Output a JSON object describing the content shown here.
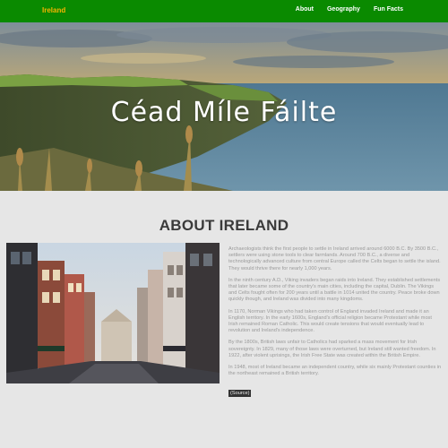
{
  "nav": {
    "brand": "Ireland",
    "links": [
      "About",
      "Geography",
      "Fun Facts"
    ]
  },
  "hero": {
    "title": "Céad Míle Fáilte"
  },
  "about": {
    "heading": "ABOUT IRELAND",
    "paragraphs": [
      "Archaeologists think the first people to settle in Ireland arrived around 6000 B.C. By 3500 B.C., settlers were using stone tools to clear farmlands. Around 700 B.C., a diverse and technologically advanced culture from central Europe called the Celts began to settle the island. They would thrive there for nearly 1,000 years.",
      "In the ninth century A.D., Viking invaders began raids into Ireland. They established settlements that later became some of the country's main cities, including the capital, Dublin. The Vikings and Celts fought often for 200 years until a battle in 1014 united the country. Peace broke down quickly though, and Ireland was divided into many kingdoms.",
      "In 1170, Norman Vikings who had taken control of England invaded Ireland and made it an English territory. In the early 1600s, England's official religion became Protestant while most Irish remained Roman Catholic. This would create tensions that would eventually lead to revolution and Ireland's independence.",
      "By the 1800s, British laws unfair to Catholics had sparked a mass movement for Irish sovereignty. In 1829, many of those laws were overturned, but Ireland still wanted freedom. In 1922, after violent uprisings, the Irish Free State was created within the British Empire.",
      "In 1948, most of Ireland became an independent country, while six mainly Protestant counties in the northeast remained a British territory."
    ],
    "source_label": "(Source)"
  },
  "colors": {
    "nav_bg": "#0a8a00",
    "brand": "#f5b400",
    "page_bg": "#e6e6e6"
  }
}
